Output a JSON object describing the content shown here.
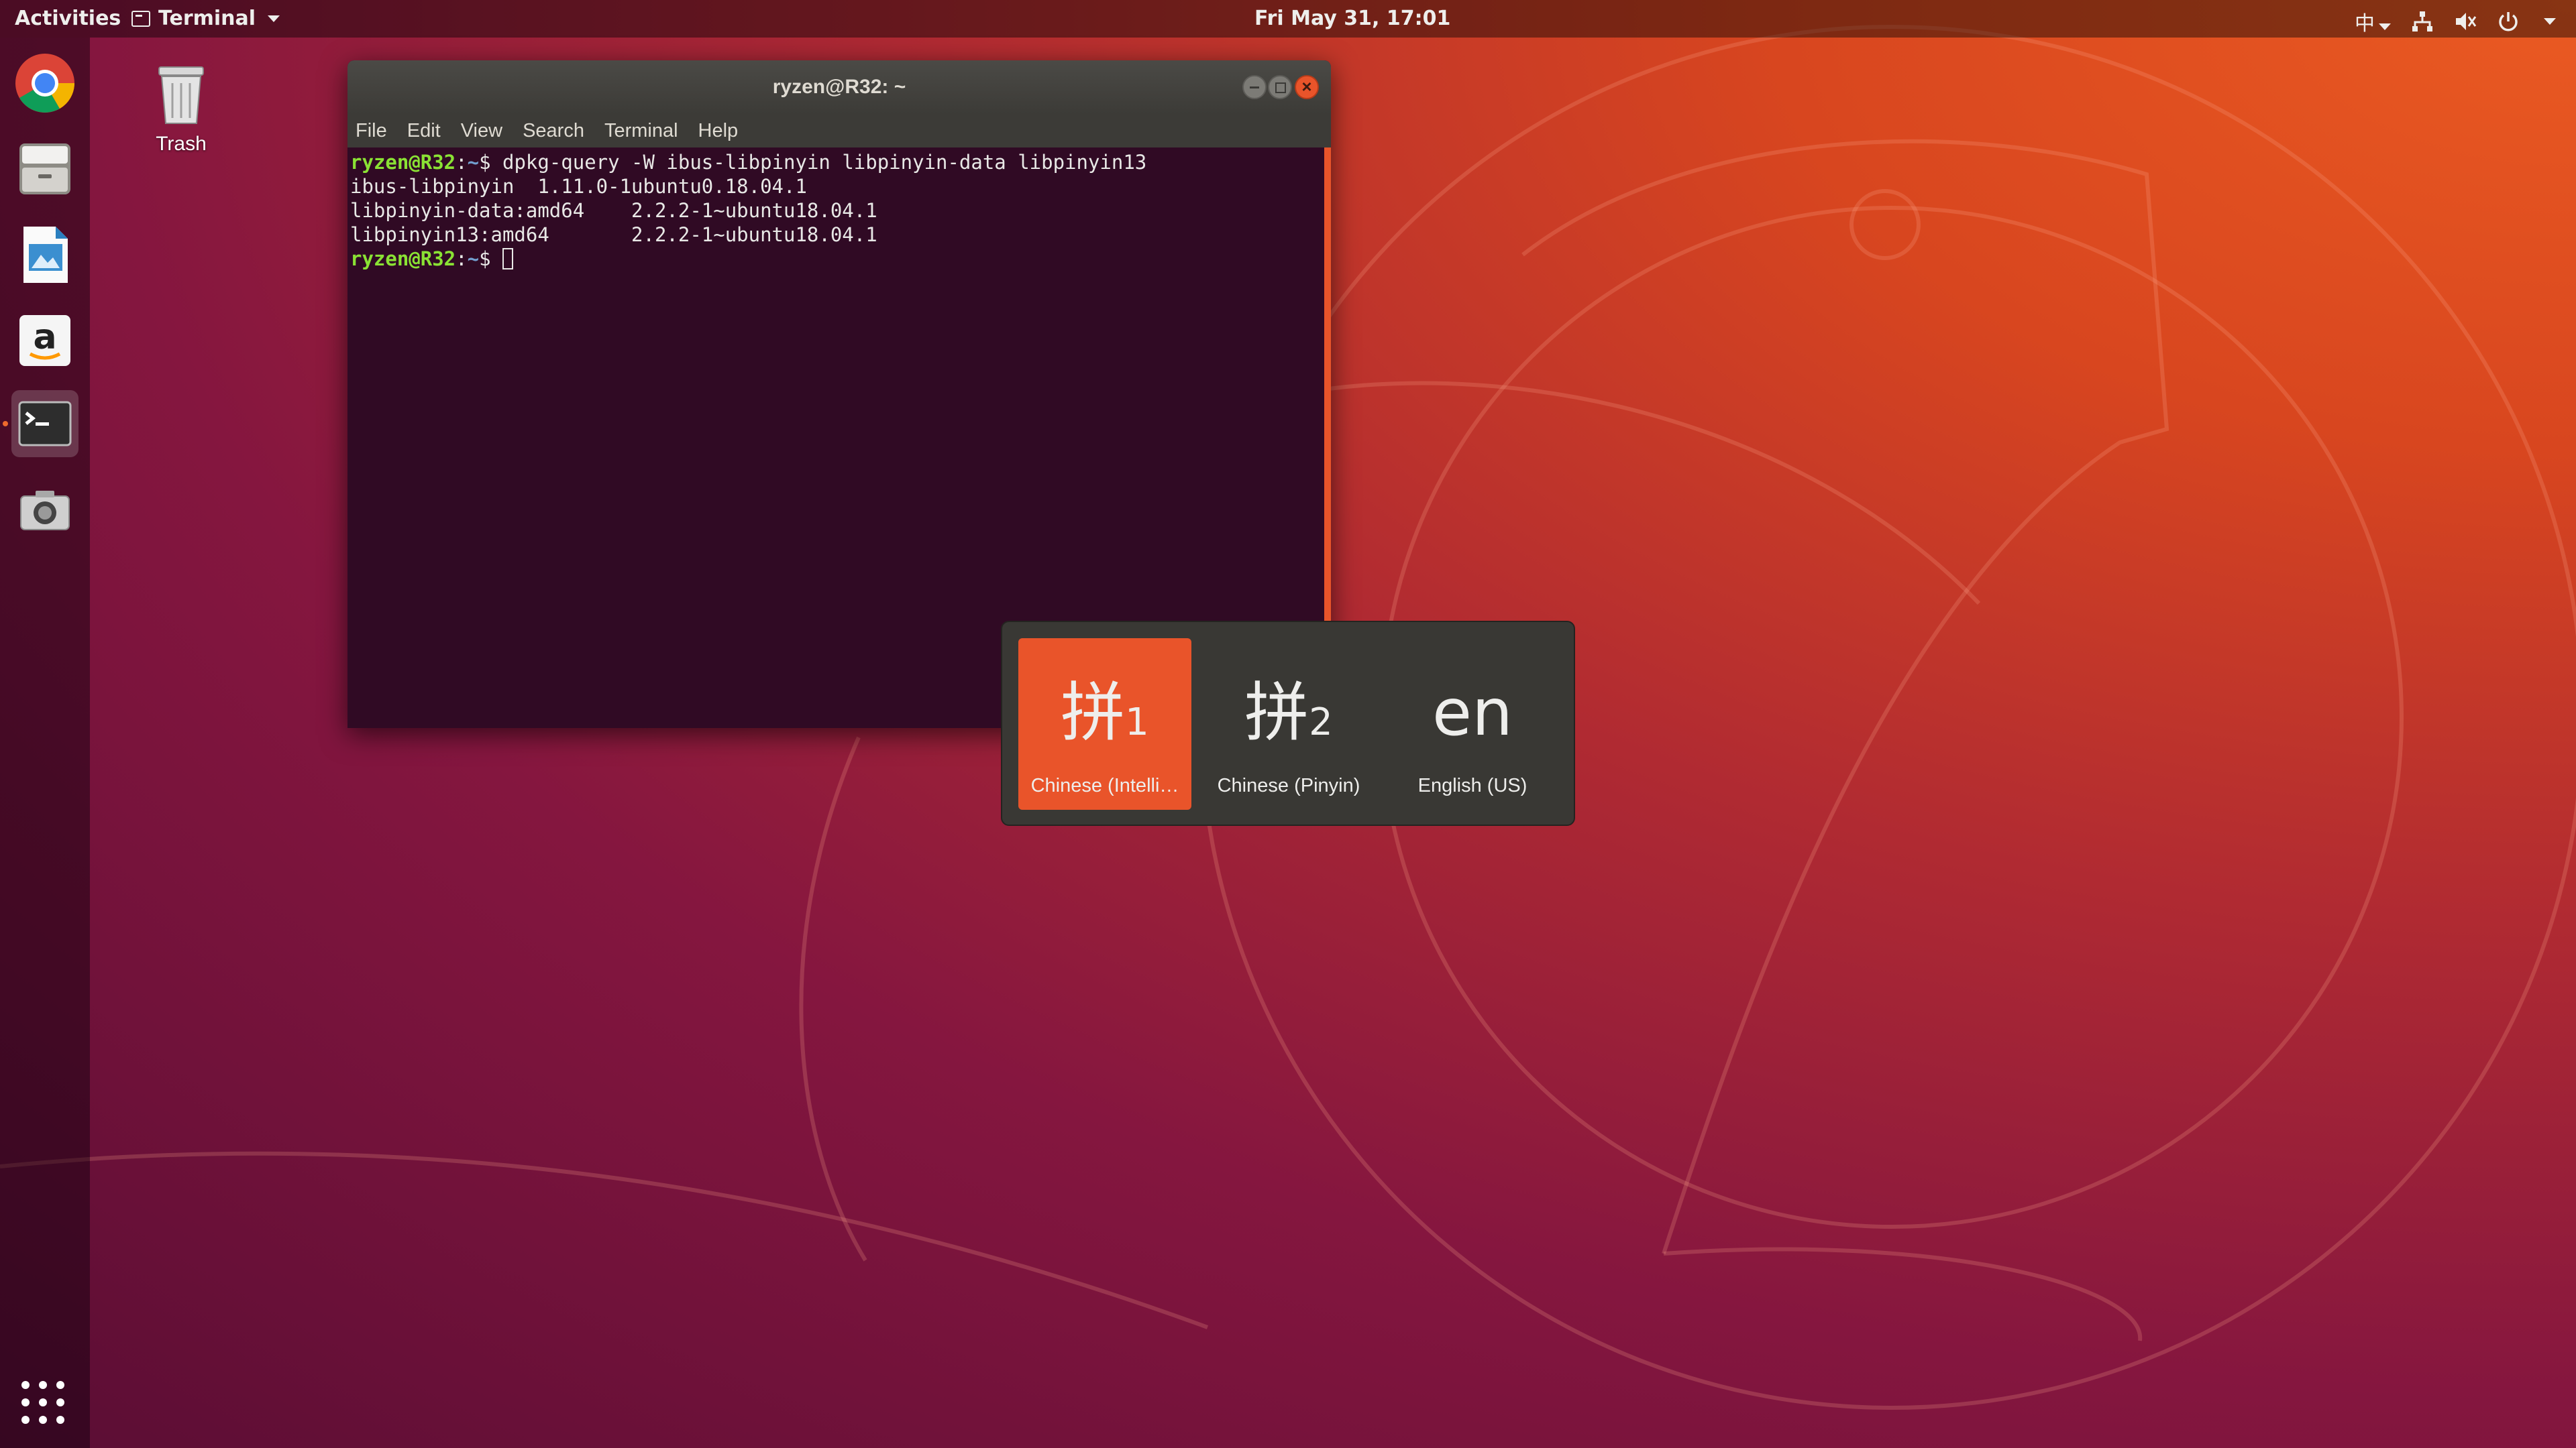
{
  "topbar": {
    "activities": "Activities",
    "app_menu": "Terminal",
    "clock": "Fri May 31, 17:01",
    "input_method": "中"
  },
  "dock": {
    "items": [
      {
        "icon": "chrome-icon"
      },
      {
        "icon": "files-icon"
      },
      {
        "icon": "libreoffice-impress-icon"
      },
      {
        "icon": "amazon-icon"
      },
      {
        "icon": "terminal-icon",
        "active": true
      },
      {
        "icon": "screenshot-camera-icon"
      }
    ]
  },
  "desktop": {
    "trash_label": "Trash"
  },
  "terminal": {
    "title": "ryzen@R32: ~",
    "menu": [
      "File",
      "Edit",
      "View",
      "Search",
      "Terminal",
      "Help"
    ],
    "prompt_user": "ryzen@R32",
    "prompt_path": "~",
    "command": "dpkg-query -W ibus-libpinyin libpinyin-data libpinyin13",
    "output": [
      "ibus-libpinyin  1.11.0-1ubuntu0.18.04.1",
      "libpinyin-data:amd64    2.2.2-1~ubuntu18.04.1",
      "libpinyin13:amd64       2.2.2-1~ubuntu18.04.1"
    ]
  },
  "switcher": {
    "items": [
      {
        "glyph": "拼",
        "sub": "1",
        "label": "Chinese (Intelli…"
      },
      {
        "glyph": "拼",
        "sub": "2",
        "label": "Chinese (Pinyin)"
      },
      {
        "glyph": "en",
        "sub": "",
        "label": "English (US)"
      }
    ],
    "selected_index": 0
  },
  "colors": {
    "accent": "#e9542a",
    "terminal_bg": "#300a24",
    "prompt_green": "#8ae234",
    "path_blue": "#729fcf"
  }
}
